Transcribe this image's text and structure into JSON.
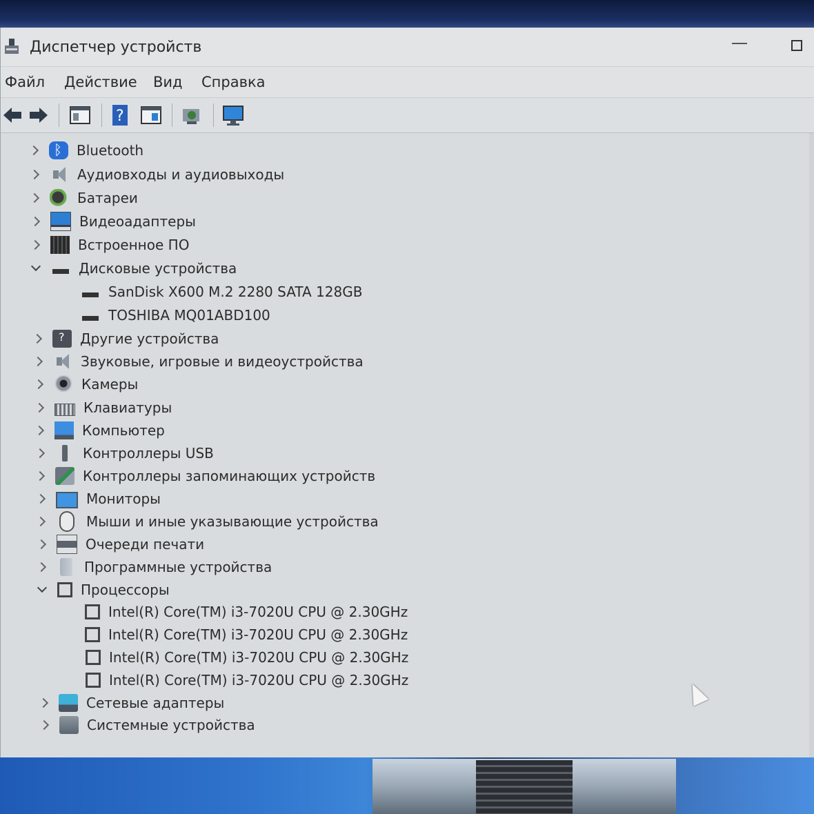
{
  "window": {
    "title": "Диспетчер устройств",
    "icon": "device-manager-icon"
  },
  "menu": [
    "Файл",
    "Действие",
    "Вид",
    "Справка"
  ],
  "toolbar": [
    {
      "icon": "back-arrow-icon"
    },
    {
      "icon": "forward-arrow-icon"
    },
    {
      "icon": "properties-icon"
    },
    {
      "icon": "help-icon"
    },
    {
      "icon": "view-icon"
    },
    {
      "icon": "update-driver-icon"
    },
    {
      "icon": "scan-hardware-icon"
    }
  ],
  "tree": [
    {
      "label": "Bluetooth",
      "expanded": false,
      "icon": "bluetooth-icon"
    },
    {
      "label": "Аудиовходы и аудиовыходы",
      "expanded": false,
      "icon": "speaker-icon"
    },
    {
      "label": "Батареи",
      "expanded": false,
      "icon": "battery-icon"
    },
    {
      "label": "Видеоадаптеры",
      "expanded": false,
      "icon": "display-adapter-icon"
    },
    {
      "label": "Встроенное ПО",
      "expanded": false,
      "icon": "firmware-icon"
    },
    {
      "label": "Дисковые устройства",
      "expanded": true,
      "icon": "disk-drive-icon",
      "children": [
        "SanDisk X600 M.2 2280 SATA 128GB",
        "TOSHIBA MQ01ABD100"
      ]
    },
    {
      "label": "Другие устройства",
      "expanded": false,
      "icon": "unknown-device-icon"
    },
    {
      "label": "Звуковые, игровые и видеоустройства",
      "expanded": false,
      "icon": "sound-icon"
    },
    {
      "label": "Камеры",
      "expanded": false,
      "icon": "camera-icon"
    },
    {
      "label": "Клавиатуры",
      "expanded": false,
      "icon": "keyboard-icon"
    },
    {
      "label": "Компьютер",
      "expanded": false,
      "icon": "computer-icon"
    },
    {
      "label": "Контроллеры USB",
      "expanded": false,
      "icon": "usb-icon"
    },
    {
      "label": "Контроллеры запоминающих устройств",
      "expanded": false,
      "icon": "storage-controller-icon"
    },
    {
      "label": "Мониторы",
      "expanded": false,
      "icon": "monitor-icon"
    },
    {
      "label": "Мыши и иные указывающие устройства",
      "expanded": false,
      "icon": "mouse-icon"
    },
    {
      "label": "Очереди печати",
      "expanded": false,
      "icon": "printer-icon"
    },
    {
      "label": "Программные устройства",
      "expanded": false,
      "icon": "software-device-icon"
    },
    {
      "label": "Процессоры",
      "expanded": true,
      "icon": "processor-icon",
      "children": [
        "Intel(R) Core(TM) i3-7020U CPU @ 2.30GHz",
        "Intel(R) Core(TM) i3-7020U CPU @ 2.30GHz",
        "Intel(R) Core(TM) i3-7020U CPU @ 2.30GHz",
        "Intel(R) Core(TM) i3-7020U CPU @ 2.30GHz"
      ]
    },
    {
      "label": "Сетевые адаптеры",
      "expanded": false,
      "icon": "network-adapter-icon"
    },
    {
      "label": "Системные устройства",
      "expanded": false,
      "icon": "system-device-icon"
    }
  ]
}
